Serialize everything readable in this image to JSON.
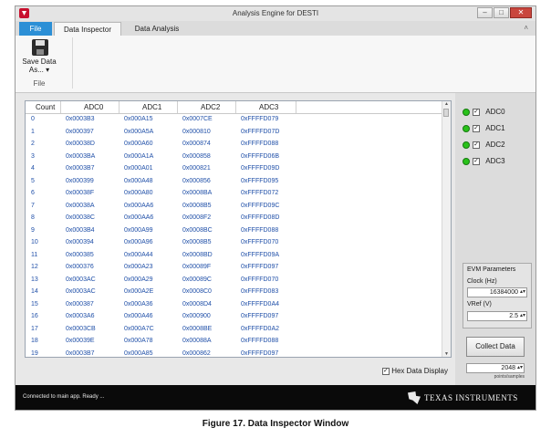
{
  "window": {
    "title": "Analysis Engine for DESTI"
  },
  "controls": {
    "minimize": "–",
    "maximize": "□",
    "close": "✕",
    "collapse": "˄"
  },
  "ribbon": {
    "tabs": [
      "File",
      "Data Inspector",
      "Data Analysis"
    ],
    "save_label": "Save Data As... ▾",
    "group_label": "File"
  },
  "grid": {
    "columns": [
      "Count",
      "ADC0",
      "ADC1",
      "ADC2",
      "ADC3"
    ],
    "rows": [
      [
        "0",
        "0x0003B3",
        "0x000A15",
        "0x0007CE",
        "0xFFFFD079"
      ],
      [
        "1",
        "0x000397",
        "0x000A5A",
        "0x000810",
        "0xFFFFD07D"
      ],
      [
        "2",
        "0x00038D",
        "0x000A60",
        "0x000874",
        "0xFFFFD088"
      ],
      [
        "3",
        "0x0003BA",
        "0x000A1A",
        "0x000858",
        "0xFFFFD06B"
      ],
      [
        "4",
        "0x0003B7",
        "0x000A01",
        "0x000821",
        "0xFFFFD09D"
      ],
      [
        "5",
        "0x000399",
        "0x000A48",
        "0x000856",
        "0xFFFFD095"
      ],
      [
        "6",
        "0x00038F",
        "0x000A80",
        "0x0008BA",
        "0xFFFFD072"
      ],
      [
        "7",
        "0x00038A",
        "0x000AA6",
        "0x0008B5",
        "0xFFFFD09C"
      ],
      [
        "8",
        "0x00038C",
        "0x000AA6",
        "0x0008F2",
        "0xFFFFD08D"
      ],
      [
        "9",
        "0x0003B4",
        "0x000A99",
        "0x0008BC",
        "0xFFFFD088"
      ],
      [
        "10",
        "0x000394",
        "0x000A96",
        "0x0008B5",
        "0xFFFFD070"
      ],
      [
        "11",
        "0x000385",
        "0x000A44",
        "0x0008BD",
        "0xFFFFD09A"
      ],
      [
        "12",
        "0x000376",
        "0x000A23",
        "0x00089F",
        "0xFFFFD097"
      ],
      [
        "13",
        "0x0003AC",
        "0x000A29",
        "0x00089C",
        "0xFFFFD070"
      ],
      [
        "14",
        "0x0003AC",
        "0x000A2E",
        "0x0008C0",
        "0xFFFFD083"
      ],
      [
        "15",
        "0x000387",
        "0x000A36",
        "0x0008D4",
        "0xFFFFD0A4"
      ],
      [
        "16",
        "0x0003A6",
        "0x000A46",
        "0x000900",
        "0xFFFFD097"
      ],
      [
        "17",
        "0x0003CB",
        "0x000A7C",
        "0x0008BE",
        "0xFFFFD0A2"
      ],
      [
        "18",
        "0x00039E",
        "0x000A78",
        "0x00088A",
        "0xFFFFD088"
      ],
      [
        "19",
        "0x0003B7",
        "0x000A85",
        "0x000862",
        "0xFFFFD097"
      ]
    ],
    "hex_label": "Hex Data Display",
    "hex_checked": "✓"
  },
  "side": {
    "channels": [
      "ADC0",
      "ADC1",
      "ADC2",
      "ADC3"
    ],
    "channel_check": "✓",
    "evm_title": "EVM Parameters",
    "clock_label": "Clock (Hz)",
    "clock_value": "16384000",
    "vref_label": "VRef (V)",
    "vref_value": "2.5",
    "spin_arrows": "▴▾",
    "collect_label": "Collect Data",
    "points_value": "2048",
    "points_unit": "points/samples"
  },
  "status": {
    "text": "Connected to main app.  Ready ...",
    "brand": "TEXAS INSTRUMENTS"
  },
  "caption": "Figure 17. Data Inspector Window",
  "colors": {
    "accent": "#2b8fd6",
    "cell_text": "#1f4fa8",
    "led": "#29c21a",
    "statusbar": "#0a0a0a"
  }
}
